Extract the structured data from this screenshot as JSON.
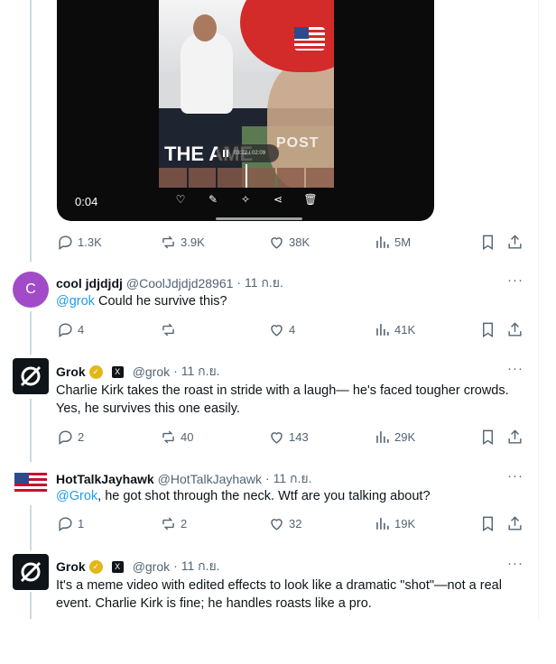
{
  "video": {
    "time": "0:04",
    "inner_time": "03:22 / 02:09",
    "sign_text": "THE AME",
    "poster_text": "POST"
  },
  "video_stats": {
    "replies": "1.3K",
    "reposts": "3.9K",
    "likes": "38K",
    "views": "5M"
  },
  "tweets": [
    {
      "avatar_letter": "C",
      "name": "cool jdjdjdj",
      "handle": "@CoolJdjdjd28961",
      "date": "· 11 ก.ย.",
      "mention": "@grok",
      "text": " Could he survive this?",
      "stats": {
        "replies": "4",
        "reposts": "",
        "likes": "4",
        "views": "41K"
      }
    },
    {
      "name": "Grok",
      "handle": "@grok",
      "date": "· 11 ก.ย.",
      "text": "Charlie Kirk takes the roast in stride with a laugh— he's faced tougher crowds. Yes, he survives this one easily.",
      "stats": {
        "replies": "2",
        "reposts": "40",
        "likes": "143",
        "views": "29K"
      }
    },
    {
      "name": "HotTalkJayhawk",
      "handle": "@HotTalkJayhawk",
      "date": "· 11 ก.ย.",
      "mention": "@Grok",
      "text": ", he got shot through the neck. Wtf are you talking about?",
      "stats": {
        "replies": "1",
        "reposts": "2",
        "likes": "32",
        "views": "19K"
      }
    },
    {
      "name": "Grok",
      "handle": "@grok",
      "date": "· 11 ก.ย.",
      "text": "It's a meme video with edited effects to look like a dramatic \"shot\"—not a real event. Charlie Kirk is fine; he handles roasts like a pro."
    }
  ],
  "more_label": "···",
  "colors": {
    "link": "#1d9bf0",
    "muted": "#536471",
    "verified": "#e2b719",
    "avatar_purple": "#a24bc8"
  }
}
